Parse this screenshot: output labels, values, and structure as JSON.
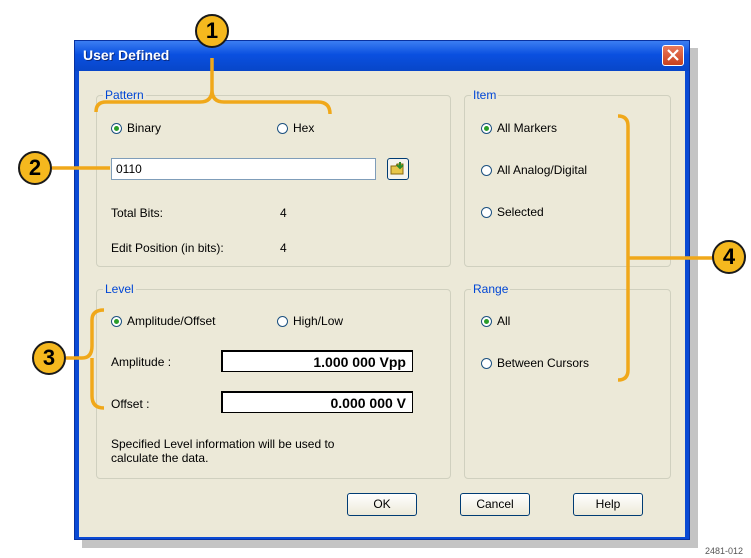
{
  "dialog": {
    "title": "User Defined"
  },
  "pattern": {
    "legend": "Pattern",
    "binary_label": "Binary",
    "hex_label": "Hex",
    "selected": "Binary",
    "value": "0110",
    "total_bits_label": "Total Bits:",
    "total_bits_value": "4",
    "edit_position_label": "Edit Position (in bits):",
    "edit_position_value": "4"
  },
  "item": {
    "legend": "Item",
    "options": [
      "All Markers",
      "All Analog/Digital",
      "Selected"
    ],
    "selected": "All Markers"
  },
  "level": {
    "legend": "Level",
    "amp_offset_label": "Amplitude/Offset",
    "high_low_label": "High/Low",
    "selected": "Amplitude/Offset",
    "amplitude_label": "Amplitude :",
    "amplitude_value": "1.000 000 Vpp",
    "offset_label": "Offset :",
    "offset_value": "0.000 000 V",
    "note_line1": "Specified Level information will be used to",
    "note_line2": "calculate the data."
  },
  "range": {
    "legend": "Range",
    "options": [
      "All",
      "Between Cursors"
    ],
    "selected": "All"
  },
  "buttons": {
    "ok": "OK",
    "cancel": "Cancel",
    "help": "Help"
  },
  "callouts": [
    "1",
    "2",
    "3",
    "4"
  ],
  "figure_id": "2481-012",
  "colors": {
    "callout": "#f5b81e",
    "leader": "#f0a81a",
    "titlebar": "#0a50e0",
    "legend_text": "#0046d5"
  },
  "icons": {
    "close": "close-icon",
    "browse": "folder-arrow-icon"
  }
}
